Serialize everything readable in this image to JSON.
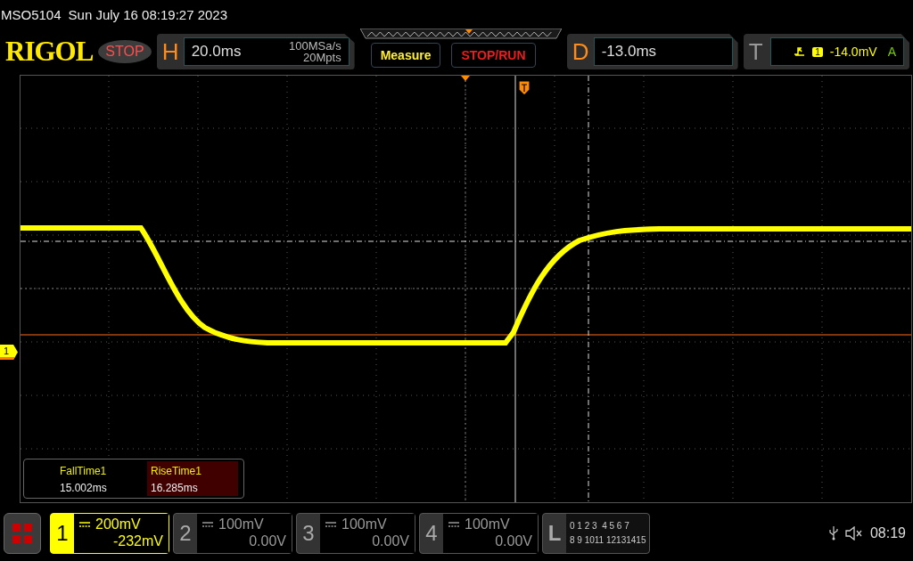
{
  "header": {
    "model": "MSO5104",
    "datetime": "Sun July 16 08:19:27 2023"
  },
  "logo": "RIGOL",
  "run_state": "STOP",
  "horizontal": {
    "label": "H",
    "timebase": "20.0ms",
    "sample_rate": "100MSa/s",
    "memory_depth": "20Mpts"
  },
  "buttons": [
    {
      "label": "Measure",
      "kind": "measure"
    },
    {
      "label": "STOP/RUN",
      "kind": "run"
    }
  ],
  "delay": {
    "label": "D",
    "value": "-13.0ms"
  },
  "trigger": {
    "label": "T",
    "source": "1",
    "level": "-14.0mV",
    "mode": "A"
  },
  "channel_marker": "1",
  "measurements": [
    {
      "name": "FallTime1",
      "value": "15.002ms",
      "selected": false
    },
    {
      "name": "RiseTime1",
      "value": "16.285ms",
      "selected": true
    }
  ],
  "channels": [
    {
      "number": "1",
      "scale": "200mV",
      "offset": "-232mV",
      "on": true
    },
    {
      "number": "2",
      "scale": "100mV",
      "offset": "0.00V",
      "on": false
    },
    {
      "number": "3",
      "scale": "100mV",
      "offset": "0.00V",
      "on": false
    },
    {
      "number": "4",
      "scale": "100mV",
      "offset": "0.00V",
      "on": false
    }
  ],
  "logic": {
    "label": "L",
    "row_1": "0 1 2 3  4 5 6 7",
    "row_2": "8 9 1011 12131415"
  },
  "status": {
    "time": "08:19"
  }
}
